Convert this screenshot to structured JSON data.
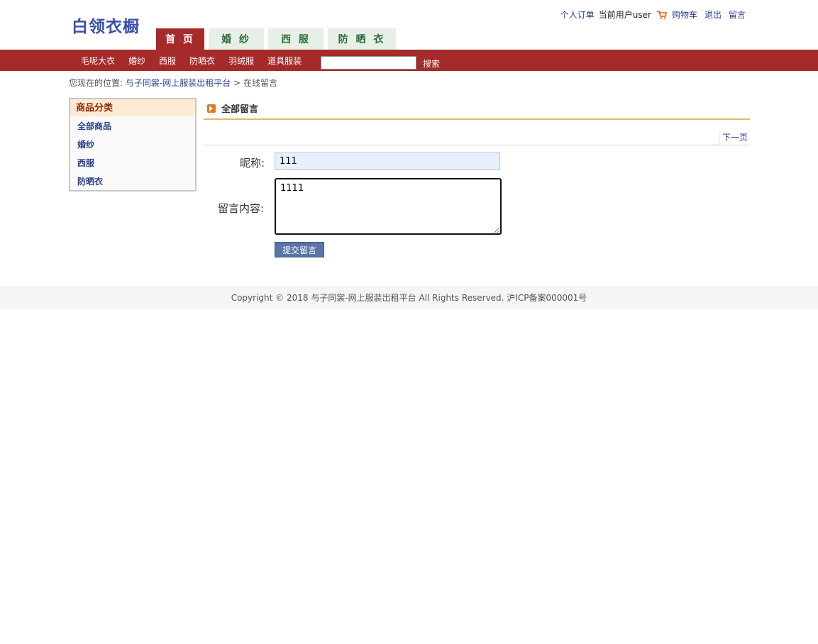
{
  "header": {
    "logo": "白领衣橱",
    "links": {
      "orders": "个人订单",
      "current_user": "当前用户user",
      "cart": "购物车",
      "logout": "退出",
      "message": "留言"
    },
    "tabs": [
      "首 页",
      "婚 纱",
      "西 服",
      "防 晒 衣"
    ]
  },
  "navbar": {
    "categories": [
      "毛呢大衣",
      "婚纱",
      "西服",
      "防晒衣",
      "羽绒服",
      "道具服装"
    ],
    "search_value": "",
    "search_label": "搜索"
  },
  "breadcrumb": {
    "prefix": "您现在的位置:",
    "home": "与子同裳-网上服装出租平台",
    "separator": ">",
    "current": "在线留言"
  },
  "sidebar": {
    "title": "商品分类",
    "items": [
      "全部商品",
      "婚纱",
      "西服",
      "防晒衣"
    ]
  },
  "main": {
    "title": "全部留言",
    "next_page": "下一页",
    "nickname_label": "昵称:",
    "nickname_value": "111",
    "content_label": "留言内容:",
    "content_value": "1111",
    "submit_label": "提交留言"
  },
  "footer": {
    "text": "Copyright © 2018 与子同裳-网上服装出租平台 All Rights Reserved. 沪ICP备案000001号"
  },
  "colors": {
    "brand_red": "#a52a2a",
    "link_blue": "#2b3f8c",
    "tab_inactive_bg": "#e6f0e6",
    "accent_orange": "#e9b36a"
  }
}
